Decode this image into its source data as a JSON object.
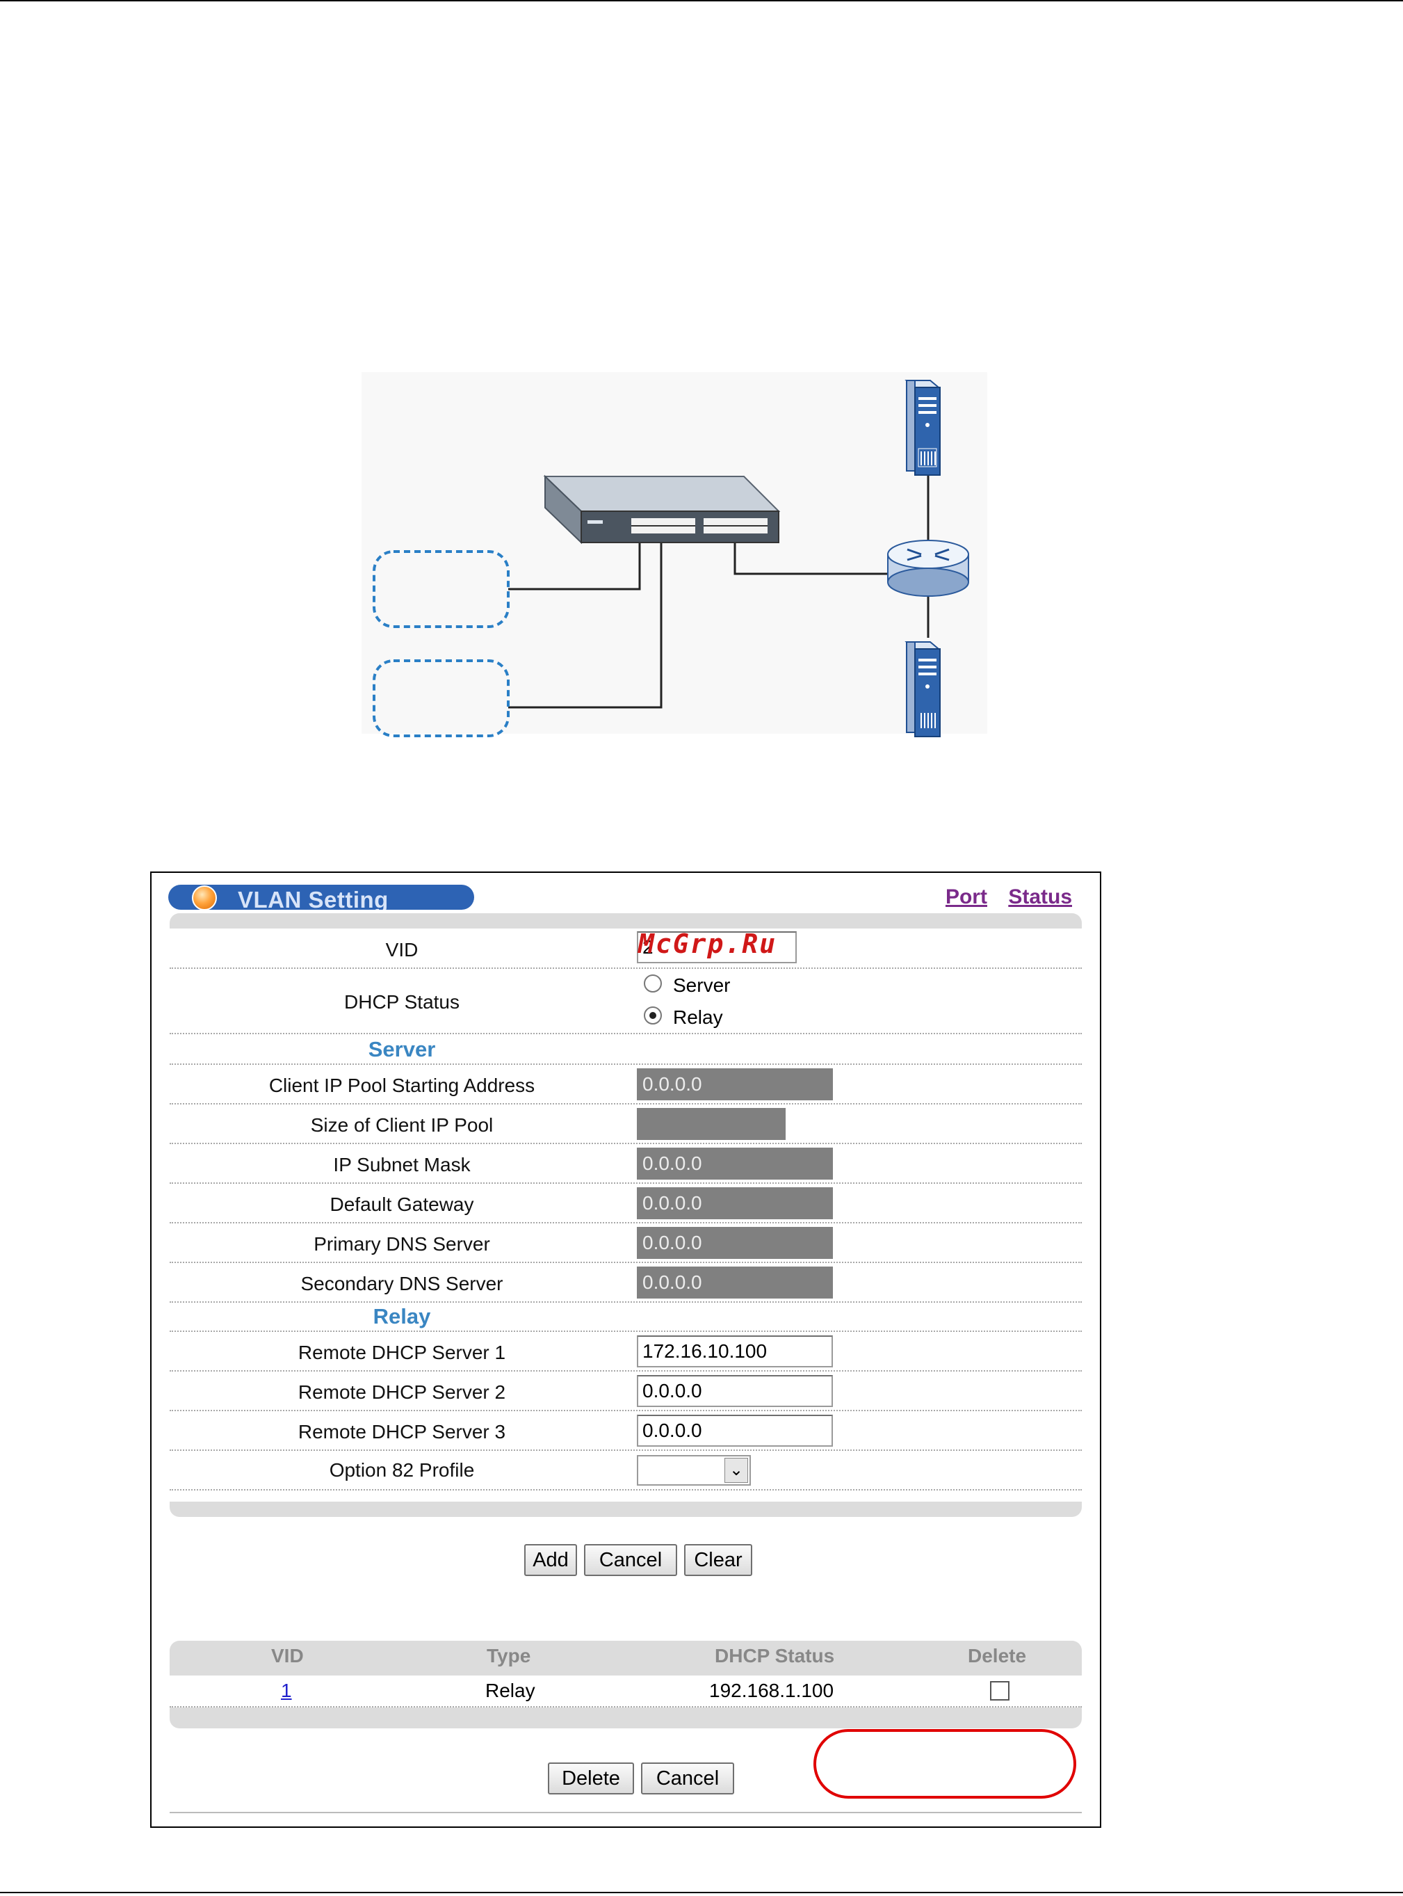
{
  "window": {
    "title": "VLAN Setting",
    "links": [
      {
        "label": "Port"
      },
      {
        "label": "Status"
      }
    ]
  },
  "form": {
    "vid": {
      "label": "VID",
      "value": "2"
    },
    "dhcp_status": {
      "label": "DHCP Status",
      "options": [
        "Server",
        "Relay"
      ],
      "selected": "Relay"
    },
    "server_section": "Server",
    "server_fields": [
      {
        "label": "Client IP Pool Starting Address",
        "value": "0.0.0.0"
      },
      {
        "label": "Size of Client IP Pool",
        "value": ""
      },
      {
        "label": "IP Subnet Mask",
        "value": "0.0.0.0"
      },
      {
        "label": "Default Gateway",
        "value": "0.0.0.0"
      },
      {
        "label": "Primary DNS Server",
        "value": "0.0.0.0"
      },
      {
        "label": "Secondary DNS Server",
        "value": "0.0.0.0"
      }
    ],
    "relay_section": "Relay",
    "relay_fields": [
      {
        "label": "Remote DHCP Server 1",
        "value": "172.16.10.100"
      },
      {
        "label": "Remote DHCP Server 2",
        "value": "0.0.0.0"
      },
      {
        "label": "Remote DHCP Server 3",
        "value": "0.0.0.0"
      }
    ],
    "option82": {
      "label": "Option 82 Profile",
      "value": ""
    }
  },
  "buttons": {
    "add": "Add",
    "cancel": "Cancel",
    "clear": "Clear",
    "delete": "Delete",
    "cancel2": "Cancel"
  },
  "table": {
    "headers": [
      "VID",
      "Type",
      "DHCP Status",
      "Delete"
    ],
    "rows": [
      {
        "vid": "1",
        "type": "Relay",
        "dhcp_status": "192.168.1.100",
        "delete": false
      }
    ]
  },
  "watermark": "McGrp.Ru",
  "colors": {
    "title_pill": "#2d63b4",
    "section": "#3a86c2",
    "link": "#7a2a8a",
    "highlight_oval": "#e00000"
  }
}
